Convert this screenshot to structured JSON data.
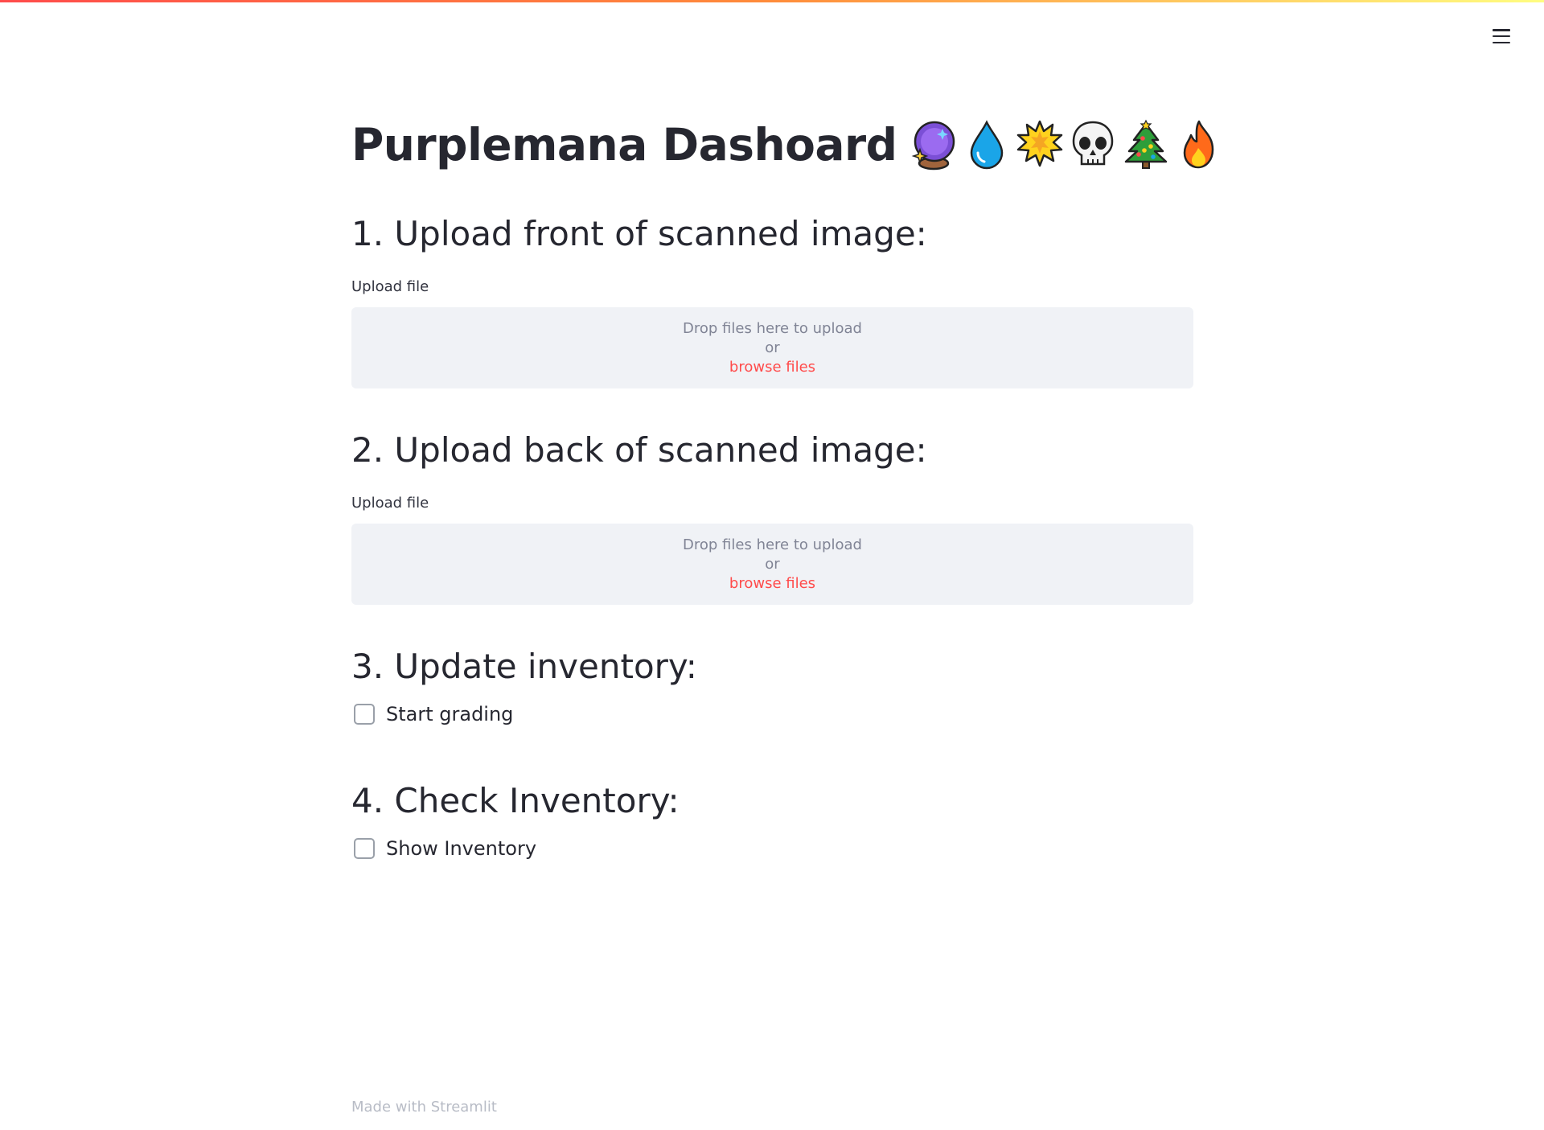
{
  "app": {
    "title": "Purplemana Dashoard",
    "title_emojis": [
      "crystal-ball-icon",
      "droplet-icon",
      "explosion-icon",
      "skull-icon",
      "christmas-tree-icon",
      "fire-icon"
    ],
    "accent_color": "#ff4b4b"
  },
  "sections": {
    "front": {
      "header": "1. Upload front of scanned image:",
      "label": "Upload file",
      "drop_text": "Drop files here to upload",
      "or_text": "or",
      "browse_text": "browse files"
    },
    "back": {
      "header": "2. Upload back of scanned image:",
      "label": "Upload file",
      "drop_text": "Drop files here to upload",
      "or_text": "or",
      "browse_text": "browse files"
    },
    "update": {
      "header": "3. Update inventory:",
      "checkbox_label": "Start grading",
      "checked": false
    },
    "check": {
      "header": "4. Check Inventory:",
      "checkbox_label": "Show Inventory",
      "checked": false
    }
  },
  "footer": {
    "prefix": "Made with",
    "brand": "Streamlit"
  },
  "menu": {
    "icon": "hamburger-menu-icon"
  }
}
